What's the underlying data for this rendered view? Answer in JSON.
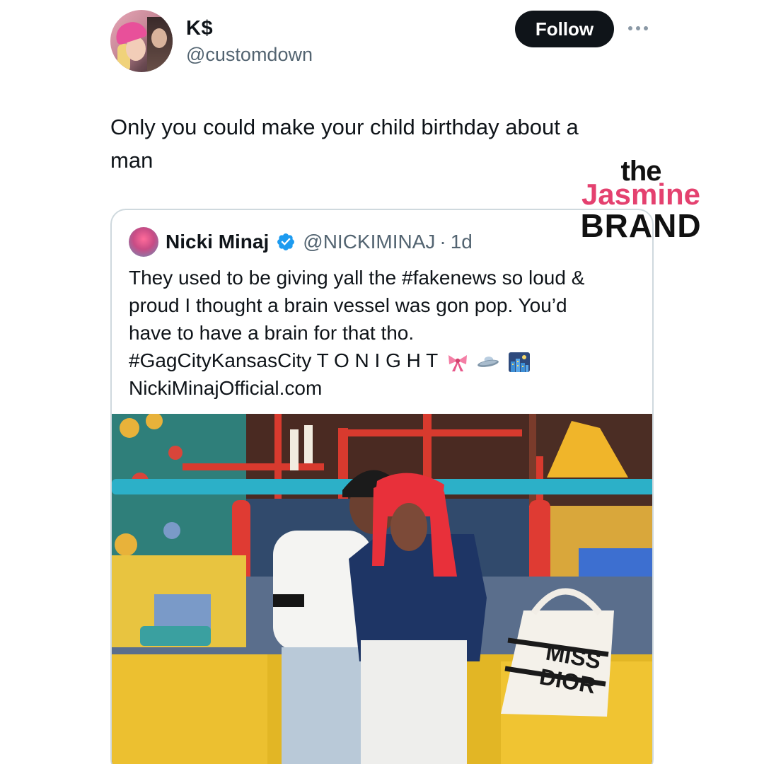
{
  "tweet": {
    "display_name": "K$",
    "handle": "@customdown",
    "follow_label": "Follow",
    "more_icon": "more-horizontal-icon",
    "text_line1": "Only you could make your child birthday about a",
    "text_line2": "man"
  },
  "watermark": {
    "the": "the",
    "jasmine": "Jasmine",
    "brand": "BRAND",
    "accent_color": "#e4416f"
  },
  "quoted_tweet": {
    "name": "Nicki Minaj",
    "verified_icon": "verified-badge-icon",
    "handle": "@NICKIMINAJ",
    "separator": "·",
    "time": "1d",
    "line1": "They used to be giving yall the #fakenews so loud &",
    "line2": "proud I thought a brain vessel was gon pop. You’d",
    "line3": "have to have a brain for that tho.",
    "line4": "#GagCityKansasCity T O N I G H T",
    "emojis": [
      "bow-emoji",
      "flying-saucer-emoji",
      "night-city-emoji"
    ],
    "line5": "NickiMinajOfficial.com",
    "photo_bag_text_1": "MISS",
    "photo_bag_text_2": "DIOR"
  },
  "colors": {
    "follow_bg": "#0f1419",
    "secondary_text": "#536471",
    "verified_blue": "#1d9bf0",
    "card_border": "#cfd9de"
  }
}
